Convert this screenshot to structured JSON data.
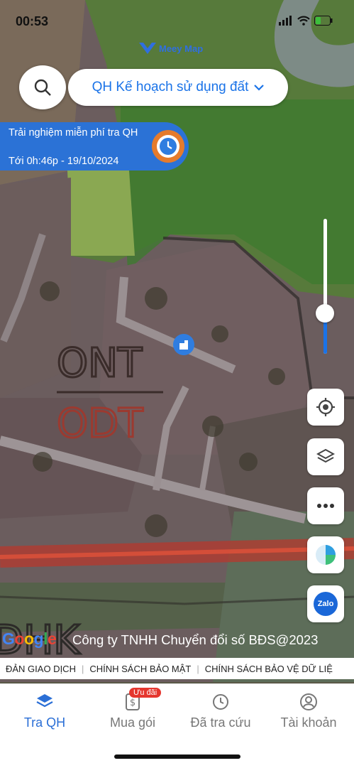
{
  "status_bar": {
    "time": "00:53"
  },
  "brand": {
    "name": "Meey Map"
  },
  "search": {
    "icon": "search-icon"
  },
  "layer_select": {
    "label": "QH Kế hoạch sử dụng đất"
  },
  "trial": {
    "line1": "Trải nghiệm miễn phí tra QH",
    "line2": "Tới 0h:46p - 19/10/2024"
  },
  "zoom_slider": {
    "level": 0.3
  },
  "map": {
    "zone_label_1": "ONT",
    "zone_label_2": "ODT",
    "zone_label_3": "DHK",
    "copyright": "Công ty TNHH Chuyển đổi số BĐS@2023",
    "google": "Google"
  },
  "policy_links": [
    "ĐẢN GIAO DỊCH",
    "CHÍNH SÁCH BẢO MẬT",
    "CHÍNH SÁCH BẢO VỆ DỮ LIỆ"
  ],
  "side_buttons": {
    "zalo_label": "Zalo"
  },
  "tabs": [
    {
      "label": "Tra QH",
      "icon": "layers-icon",
      "active": true
    },
    {
      "label": "Mua gói",
      "icon": "dollar-doc-icon",
      "badge": "Ưu đãi"
    },
    {
      "label": "Đã tra cứu",
      "icon": "clock-icon"
    },
    {
      "label": "Tài khoản",
      "icon": "user-icon"
    }
  ],
  "colors": {
    "accent": "#2b6fd6",
    "badge": "#e5362e",
    "clock": "#e57b2c"
  }
}
